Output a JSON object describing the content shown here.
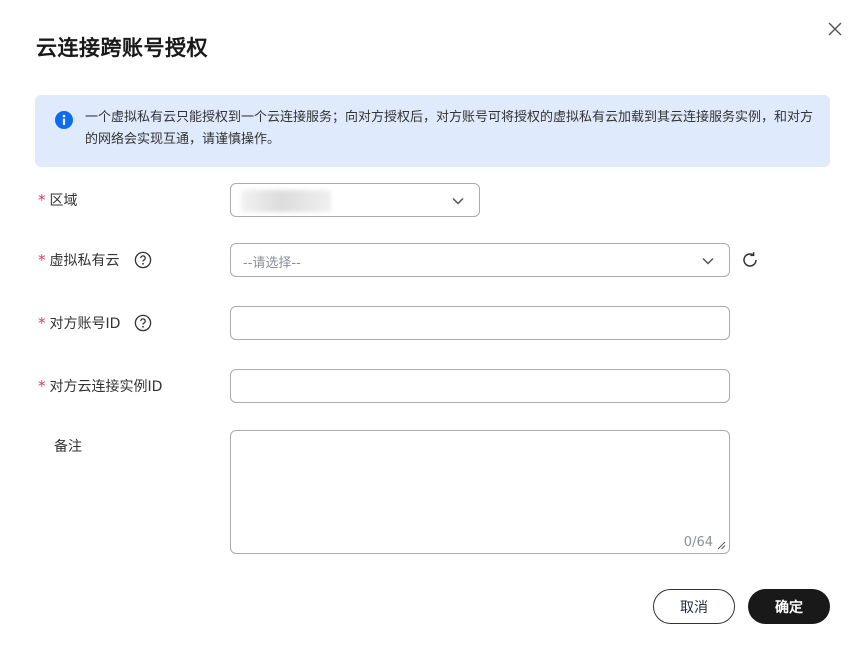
{
  "dialog": {
    "title": "云连接跨账号授权",
    "close_icon": "close-icon"
  },
  "notice": {
    "icon": "info-icon",
    "text": "一个虚拟私有云只能授权到一个云连接服务；向对方授权后，对方账号可将授权的虚拟私有云加载到其云连接服务实例，和对方的网络会实现互通，请谨慎操作。"
  },
  "form": {
    "region": {
      "label": "区域",
      "required": true,
      "value": ""
    },
    "vpc": {
      "label": "虚拟私有云",
      "required": true,
      "placeholder": "--请选择--",
      "help_icon": "question-circle-icon",
      "refresh_icon": "refresh-icon"
    },
    "peer_account": {
      "label": "对方账号ID",
      "required": true,
      "value": "",
      "help_icon": "question-circle-icon"
    },
    "peer_instance": {
      "label": "对方云连接实例ID",
      "required": true,
      "value": ""
    },
    "remark": {
      "label": "备注",
      "required": false,
      "value": "",
      "counter": "0/64"
    }
  },
  "buttons": {
    "cancel": "取消",
    "ok": "确定"
  },
  "colors": {
    "required_star": "#e7375f",
    "notice_bg": "#dfeafd",
    "info_icon": "#0d6bf2",
    "primary_button": "#191919"
  }
}
